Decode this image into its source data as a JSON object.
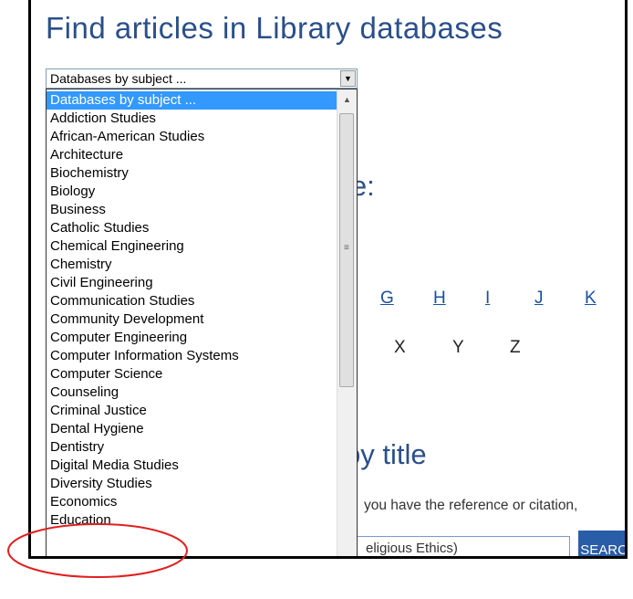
{
  "page": {
    "title": "Find articles in Library databases",
    "heading_partial_1": "le:",
    "heading_partial_2": "by title",
    "help_text_partial": "you have the reference or citation,",
    "search_input_value_partial": "eligious Ethics)",
    "search_button_label": "SEARCH",
    "letter_links_visible": [
      "G",
      "H",
      "I",
      "J",
      "K"
    ],
    "letters_row2_visible": [
      "X",
      "Y",
      "Z"
    ]
  },
  "select": {
    "selected_value": "Databases by subject ...",
    "options": [
      "Databases by subject ...",
      "Addiction Studies",
      "African-American Studies",
      "Architecture",
      "Biochemistry",
      "Biology",
      "Business",
      "Catholic Studies",
      "Chemical Engineering",
      "Chemistry",
      "Civil Engineering",
      "Communication Studies",
      "Community Development",
      "Computer Engineering",
      "Computer Information Systems",
      "Computer Science",
      "Counseling",
      "Criminal Justice",
      "Dental Hygiene",
      "Dentistry",
      "Digital Media Studies",
      "Diversity Studies",
      "Economics",
      "Education"
    ],
    "highlighted_option": "Databases by subject ..."
  },
  "icons": {
    "dropdown_arrow": "chevron-down-icon",
    "scroll_up": "scroll-up-arrow-icon",
    "scroll_grip": "scroll-grip-icon"
  },
  "colors": {
    "heading": "#2a4f8a",
    "link": "#1a4fa0",
    "selection": "#3399ff",
    "search_button": "#2a5da8",
    "annotation_circle": "#e02020"
  }
}
